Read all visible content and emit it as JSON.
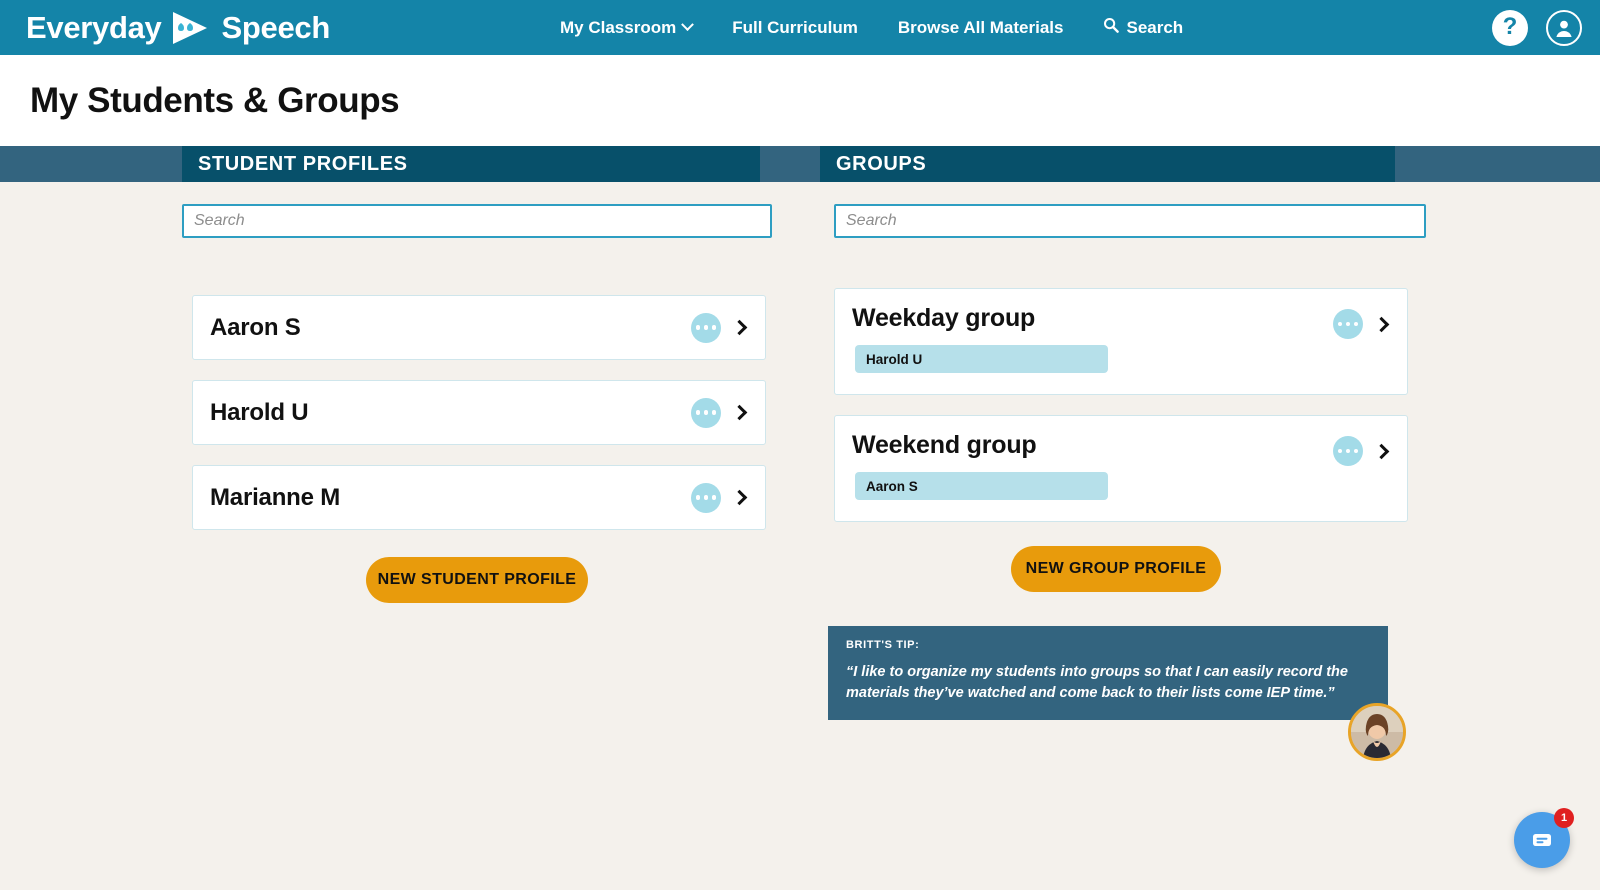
{
  "navbar": {
    "brand_left": "Everyday",
    "brand_right": "Speech",
    "brand_mark_icon": "play-quote-logo-icon",
    "links": [
      {
        "label": "My Classroom",
        "icon": "chevron-down-icon",
        "has_dropdown": true
      },
      {
        "label": "Full Curriculum",
        "has_dropdown": false
      },
      {
        "label": "Browse All Materials",
        "has_dropdown": false
      },
      {
        "label": "Search",
        "icon": "search-icon",
        "has_dropdown": false
      }
    ],
    "help_icon_label": "?",
    "account_icon": "user-account-icon",
    "background_color": "#1484a8"
  },
  "header": {
    "title": "My Students & Groups"
  },
  "sections": {
    "students": {
      "band_label": "STUDENT PROFILES",
      "search_placeholder": "Search",
      "search_value": "",
      "new_button_label": "NEW STUDENT PROFILE",
      "cards": [
        {
          "name": "Aaron S",
          "menu_icon": "ellipsis-icon",
          "open_icon": "chevron-right-icon"
        },
        {
          "name": "Harold U",
          "menu_icon": "ellipsis-icon",
          "open_icon": "chevron-right-icon"
        },
        {
          "name": "Marianne M",
          "menu_icon": "ellipsis-icon",
          "open_icon": "chevron-right-icon"
        }
      ]
    },
    "groups": {
      "band_label": "GROUPS",
      "search_placeholder": "Search",
      "search_value": "",
      "new_button_label": "NEW GROUP PROFILE",
      "cards": [
        {
          "name": "Weekday group",
          "members": [
            "Harold U"
          ],
          "menu_icon": "ellipsis-icon",
          "open_icon": "chevron-right-icon"
        },
        {
          "name": "Weekend group",
          "members": [
            "Aaron S"
          ],
          "menu_icon": "ellipsis-icon",
          "open_icon": "chevron-right-icon"
        }
      ]
    }
  },
  "tip": {
    "label": "BRITT'S TIP:",
    "quote": "“I like to organize my students into groups so that I can easily record the materials they’ve watched and come back to their lists come IEP time.”",
    "avatar_icon": "britt-portrait-avatar",
    "background_color": "#33647f",
    "avatar_ring_color": "#e8a427"
  },
  "chat": {
    "icon": "chat-message-icon",
    "badge_count": "1",
    "color": "#4a9de8",
    "badge_color": "#e02020"
  },
  "colors": {
    "page_background": "#f4f1ec",
    "band_outer": "#33647f",
    "band_inner": "#07506a",
    "accent_orange": "#e89b0c",
    "accent_teal": "#2e9ec2",
    "chip_blue": "#b6e0ea"
  }
}
